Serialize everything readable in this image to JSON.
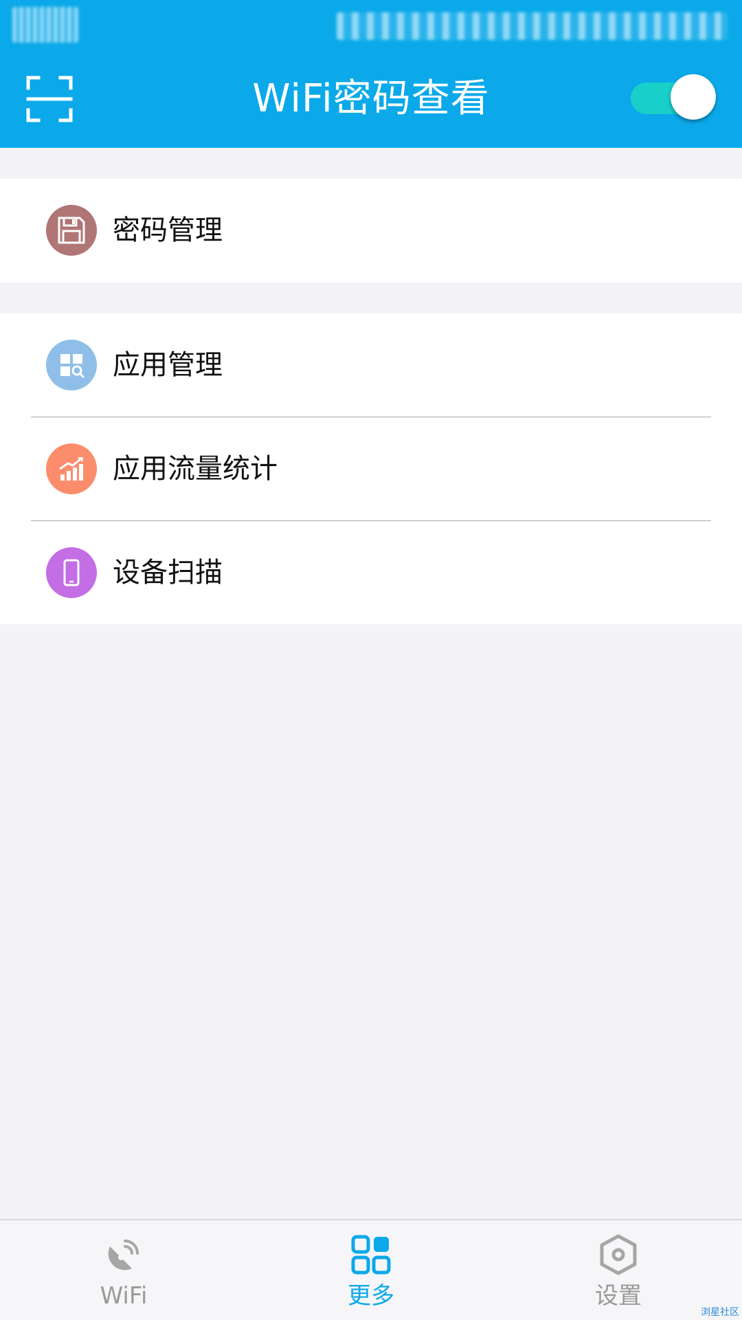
{
  "header": {
    "title": "WiFi密码查看",
    "toggle_on": true,
    "accent_color": "#0ba9e9",
    "toggle_color": "#19cfc9"
  },
  "menu": {
    "group1": [
      {
        "label": "密码管理",
        "icon": "floppy-disk-icon",
        "icon_color": "#b07575"
      }
    ],
    "group2": [
      {
        "label": "应用管理",
        "icon": "app-grid-search-icon",
        "icon_color": "#8fbfe8"
      },
      {
        "label": "应用流量统计",
        "icon": "bar-chart-trend-icon",
        "icon_color": "#fb8d6c"
      },
      {
        "label": "设备扫描",
        "icon": "phone-icon",
        "icon_color": "#c36ee5"
      }
    ]
  },
  "bottom_nav": {
    "items": [
      {
        "label": "WiFi",
        "icon": "satellite-dish-icon",
        "active": false
      },
      {
        "label": "更多",
        "icon": "four-squares-icon",
        "active": true
      },
      {
        "label": "设置",
        "icon": "hexagon-gear-icon",
        "active": false
      }
    ]
  },
  "watermark": "浏星社区"
}
